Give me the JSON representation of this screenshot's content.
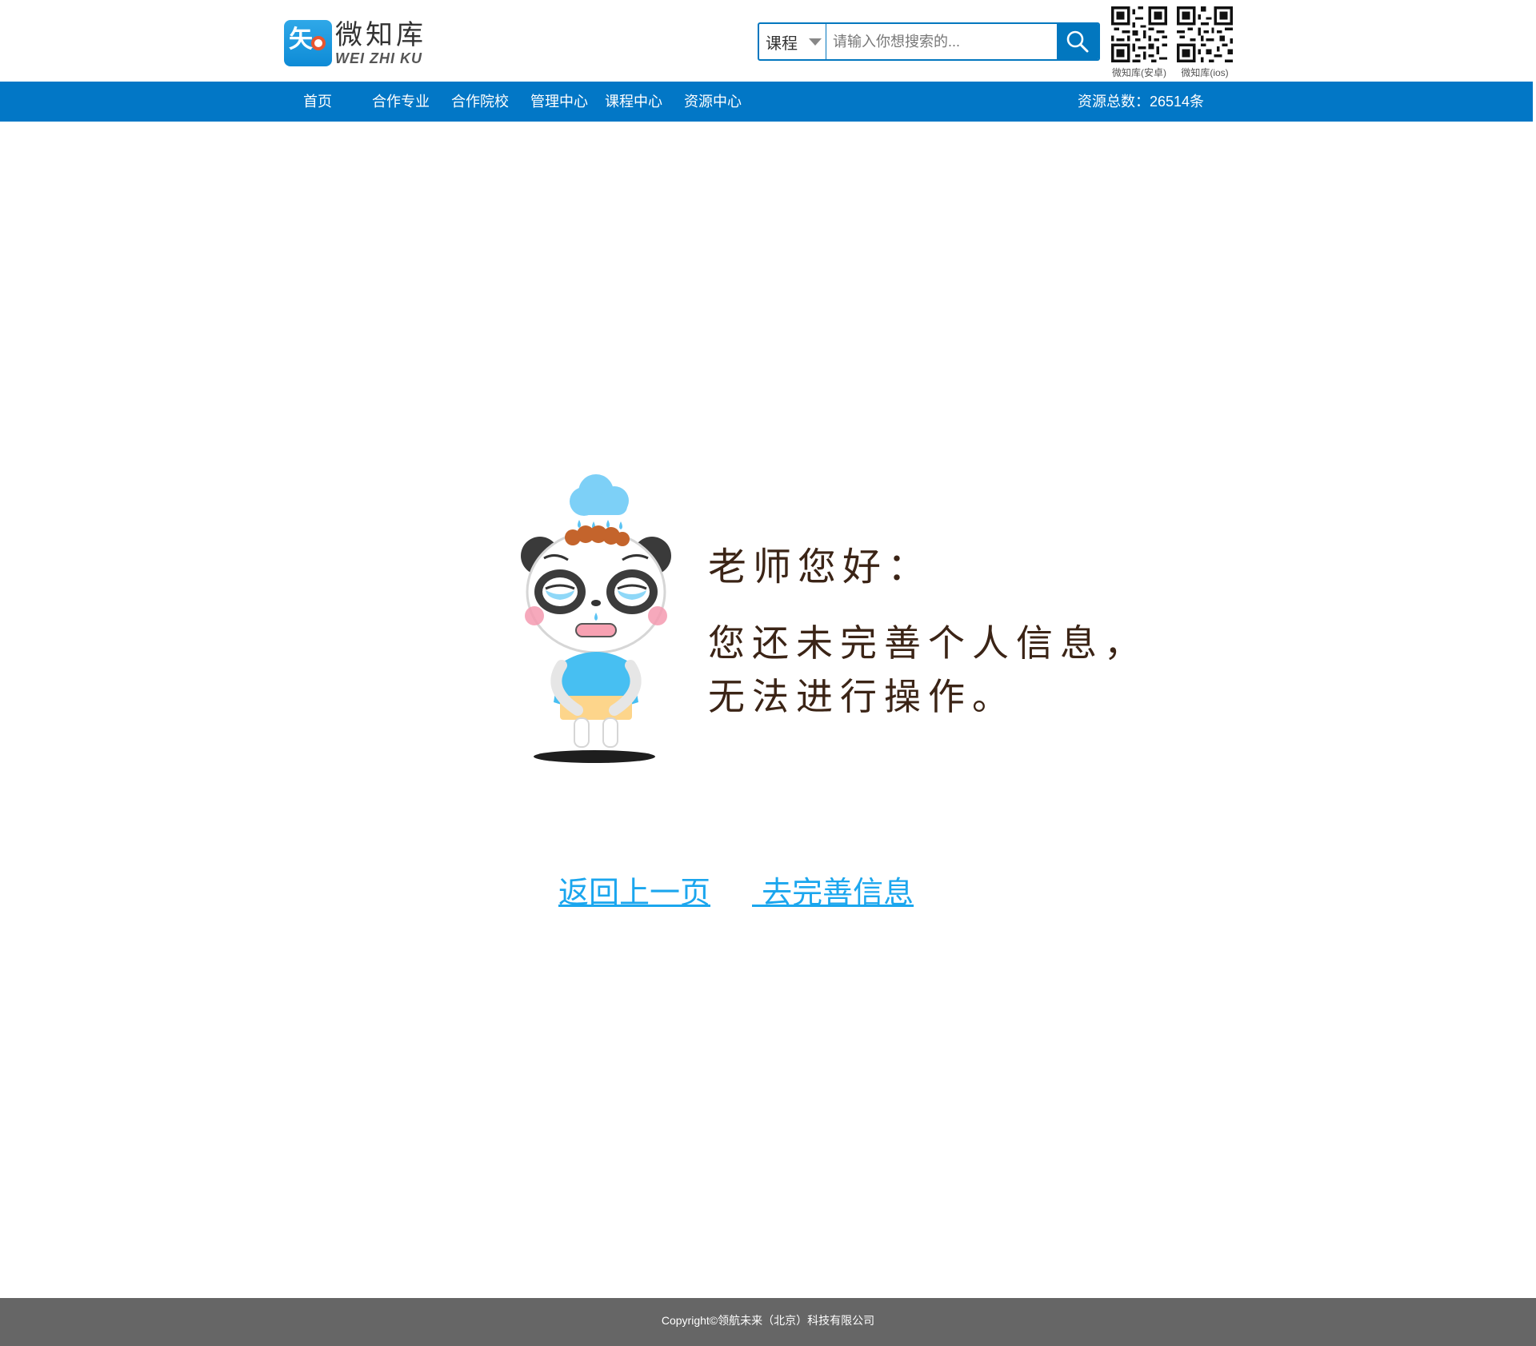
{
  "header": {
    "logo": {
      "glyph": "矢",
      "name_cn": "微知库",
      "name_en": "WEI ZHI KU"
    },
    "search": {
      "category": "课程",
      "placeholder": "请输入你想搜索的...",
      "value": ""
    },
    "qr_codes": [
      {
        "label": "微知库(安卓)"
      },
      {
        "label": "微知库(ios)"
      }
    ]
  },
  "nav": {
    "items": [
      {
        "label": "首页"
      },
      {
        "label": "合作专业"
      },
      {
        "label": "合作院校"
      },
      {
        "label": "管理中心"
      },
      {
        "label": "课程中心"
      },
      {
        "label": "资源中心"
      }
    ],
    "resource_count": "资源总数：26514条"
  },
  "main": {
    "greeting": "老师您好：",
    "message_line1": "您还未完善个人信息，",
    "message_line2": "无法进行操作。",
    "back_link": "返回上一页",
    "complete_link": " 去完善信息"
  },
  "footer": {
    "copyright": "Copyright©领航未来（北京）科技有限公司"
  },
  "colors": {
    "brand_blue": "#0277c6",
    "link_blue": "#1ba6ee",
    "footer_gray": "#666666",
    "message_brown": "#3b2416"
  }
}
